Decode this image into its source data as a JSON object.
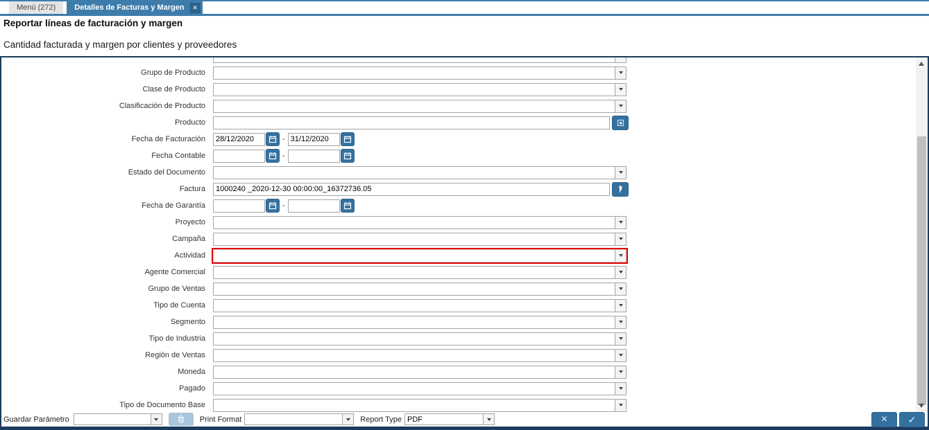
{
  "tabs": [
    {
      "label": "Menú (272)"
    },
    {
      "label": "Detalles de Facturas y Margen",
      "close_icon": "×"
    }
  ],
  "header": {
    "title": "Reportar líneas de facturación y margen",
    "subtitle": "Cantidad facturada y margen por clientes y proveedores"
  },
  "form": {
    "rows": [
      {
        "id": "partial-top-row",
        "label": "",
        "type": "combo",
        "value": ""
      },
      {
        "id": "grupo-de-producto",
        "label": "Grupo de Producto",
        "type": "combo",
        "value": ""
      },
      {
        "id": "clase-de-producto",
        "label": "Clase de Producto",
        "type": "combo",
        "value": ""
      },
      {
        "id": "clasificacion-de-producto",
        "label": "Clasificación de Producto",
        "type": "combo",
        "value": ""
      },
      {
        "id": "producto",
        "label": "Producto",
        "type": "search",
        "value": "",
        "button_icon": "search-icon"
      },
      {
        "id": "fecha-de-facturacion",
        "label": "Fecha de Facturación",
        "type": "daterange",
        "from": "28/12/2020",
        "to": "31/12/2020"
      },
      {
        "id": "fecha-contable",
        "label": "Fecha Contable",
        "type": "daterange",
        "from": "",
        "to": ""
      },
      {
        "id": "estado-del-documento",
        "label": "Estado del Documento",
        "type": "combo",
        "value": ""
      },
      {
        "id": "factura",
        "label": "Factura",
        "type": "record",
        "value": "1000240 _2020-12-30 00:00:00_16372736.05",
        "button_icon": "record-info-icon"
      },
      {
        "id": "fecha-de-garantia",
        "label": "Fecha de Garantía",
        "type": "daterange",
        "from": "",
        "to": ""
      },
      {
        "id": "proyecto",
        "label": "Proyecto",
        "type": "combo",
        "value": ""
      },
      {
        "id": "campana",
        "label": "Campaña",
        "type": "combo",
        "value": ""
      },
      {
        "id": "actividad",
        "label": "Actividad",
        "type": "combo",
        "value": "",
        "highlighted": true
      },
      {
        "id": "agente-comercial",
        "label": "Agente Comercial",
        "type": "combo",
        "value": ""
      },
      {
        "id": "grupo-de-ventas",
        "label": "Grupo de Ventas",
        "type": "combo",
        "value": ""
      },
      {
        "id": "tipo-de-cuenta",
        "label": "Tipo de Cuenta",
        "type": "combo",
        "value": ""
      },
      {
        "id": "segmento",
        "label": "Segmento",
        "type": "combo",
        "value": ""
      },
      {
        "id": "tipo-de-industria",
        "label": "Tipo de Industria",
        "type": "combo",
        "value": ""
      },
      {
        "id": "region-de-ventas",
        "label": "Región de Ventas",
        "type": "combo",
        "value": ""
      },
      {
        "id": "moneda",
        "label": "Moneda",
        "type": "combo",
        "value": ""
      },
      {
        "id": "pagado",
        "label": "Pagado",
        "type": "combo",
        "value": ""
      },
      {
        "id": "tipo-de-documento-base",
        "label": "Tipo de Documento Base",
        "type": "combo",
        "value": ""
      }
    ]
  },
  "footer": {
    "save_param_label": "Guardar Parámetro",
    "save_param_value": "",
    "print_format_label": "Print Format",
    "print_format_value": "",
    "report_type_label": "Report Type",
    "report_type_value": "PDF"
  },
  "icons": {
    "tab_close": "close-icon",
    "date_buttons": "calendar-icon",
    "product_button": "search-icon",
    "invoice_button": "record-info-icon",
    "delete_button": "trash-icon",
    "cancel_button": "close-icon",
    "confirm_button": "check-icon"
  },
  "colors": {
    "accent_blue": "#35719f",
    "tab_blue": "#3e7cab",
    "panel_navy": "#1c3b5e",
    "highlight_red": "#e60000",
    "disabled_button": "#a7c6dd"
  }
}
